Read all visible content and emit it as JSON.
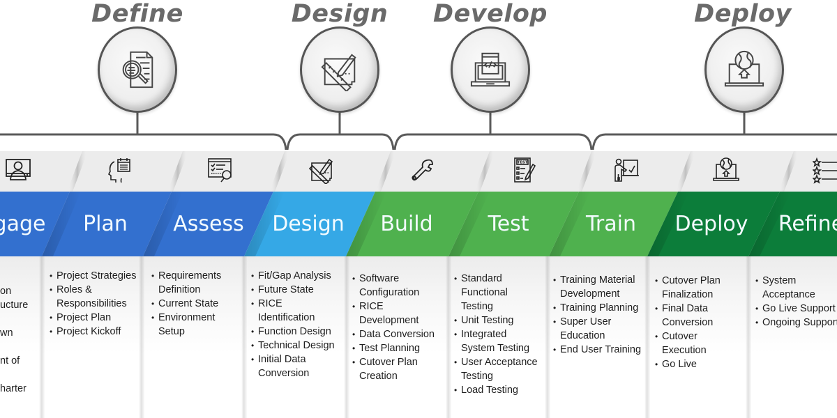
{
  "colors": {
    "blue": "#3370cf",
    "light_blue": "#35a8e6",
    "green": "#4fb14e",
    "dark_green": "#0c7d3a",
    "title_gray": "#6a6a6a"
  },
  "phases": [
    {
      "title": "Define",
      "icon": "document-magnifier-icon"
    },
    {
      "title": "Design",
      "icon": "ruler-pencil-icon"
    },
    {
      "title": "Develop",
      "icon": "laptop-code-icon"
    },
    {
      "title": "Deploy",
      "icon": "laptop-globe-upload-icon"
    }
  ],
  "steps": [
    {
      "label": "Engage",
      "visible_label": "gage",
      "icon": "user-monitor-icon",
      "color": "blue",
      "items": [
        "on",
        "ucture",
        "",
        "wn",
        "",
        "nt of",
        "",
        "harter"
      ]
    },
    {
      "label": "Plan",
      "icon": "head-calendar-icon",
      "color": "blue",
      "items": [
        "Project Strategies",
        "Roles & Responsibilities",
        "Project Plan",
        "Project Kickoff"
      ]
    },
    {
      "label": "Assess",
      "icon": "checklist-magnifier-icon",
      "color": "blue",
      "items": [
        "Requirements Definition",
        "Current State",
        "Environment Setup"
      ]
    },
    {
      "label": "Design",
      "icon": "ruler-pencil-icon",
      "color": "light_blue",
      "items": [
        "Fit/Gap Analysis",
        "Future State",
        "RICE Identification",
        "Function Design",
        "Technical Design",
        "Initial Data Conversion"
      ]
    },
    {
      "label": "Build",
      "icon": "wrench-icon",
      "color": "green",
      "items": [
        "Software Configuration",
        "RICE Development",
        "Data Conversion",
        "Test Planning",
        "Cutover Plan Creation"
      ]
    },
    {
      "label": "Test",
      "icon": "test-sheet-icon",
      "color": "green",
      "items": [
        "Standard Functional Testing",
        "Unit Testing",
        "Integrated System Testing",
        "User Acceptance Testing",
        "Load Testing"
      ]
    },
    {
      "label": "Train",
      "icon": "presenter-board-icon",
      "color": "green",
      "items": [
        "Training Material Development",
        "Training Planning",
        "Super User Education",
        "End User Training"
      ]
    },
    {
      "label": "Deploy",
      "icon": "laptop-globe-upload-icon",
      "color": "dark_green",
      "items": [
        "Cutover Plan Finalization",
        "Final Data Conversion",
        "Cutover Execution",
        "Go Live"
      ]
    },
    {
      "label": "Refine",
      "visible_label": "Refine",
      "icon": "star-list-icon",
      "color": "dark_green",
      "items": [
        "System Acceptance",
        "Go Live Support",
        "Ongoing Support"
      ]
    }
  ]
}
